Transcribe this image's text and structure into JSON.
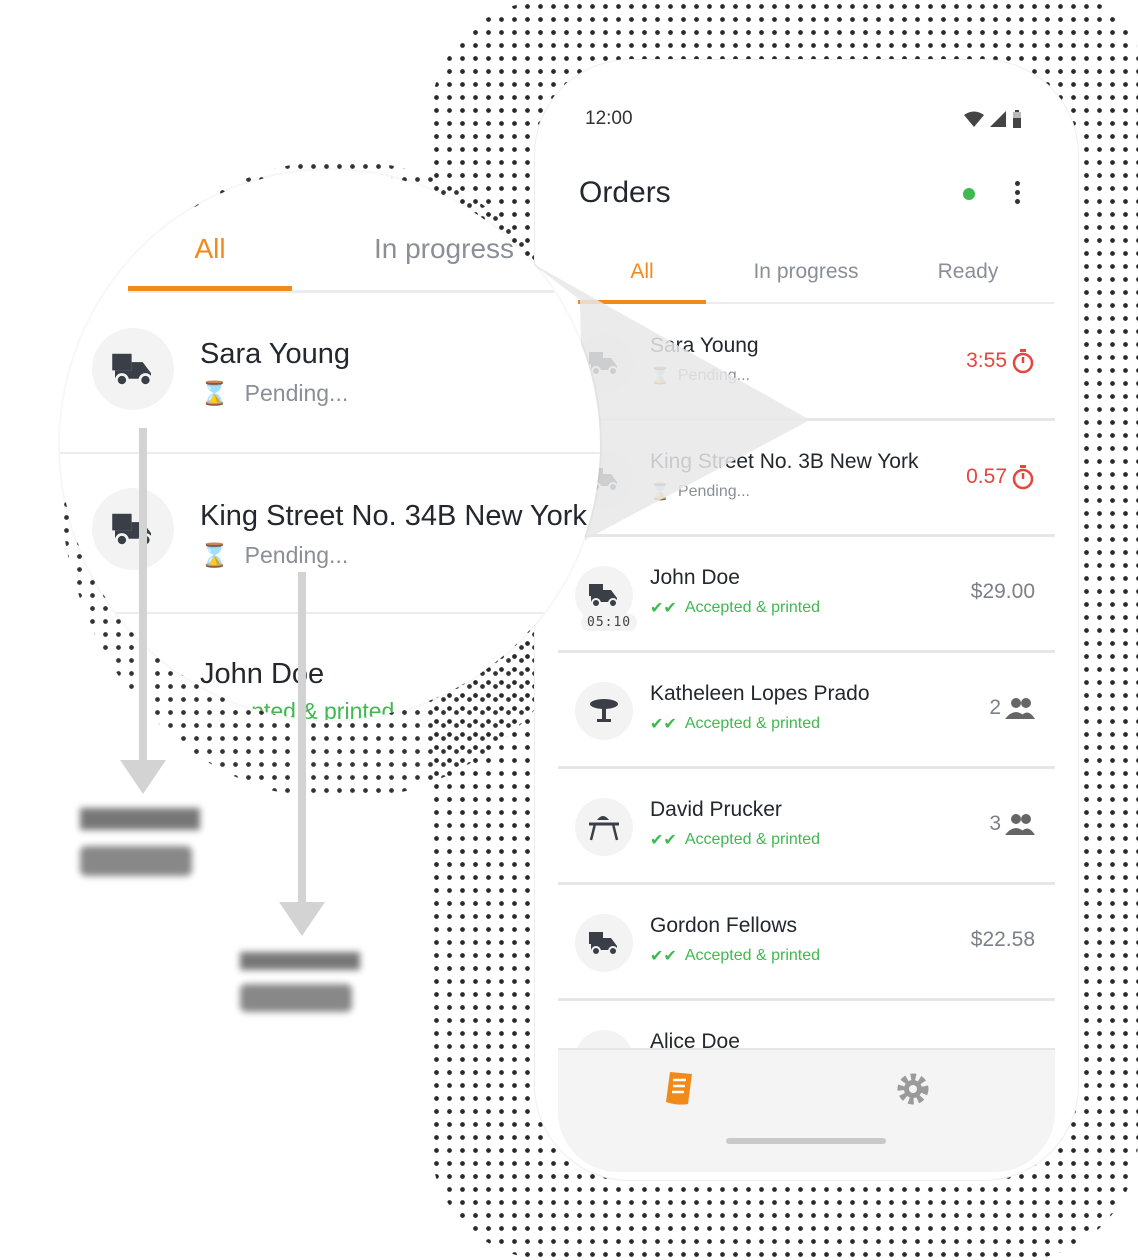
{
  "status_bar": {
    "time": "12:00"
  },
  "header": {
    "title": "Orders"
  },
  "tabs": [
    {
      "label": "All",
      "active": true
    },
    {
      "label": "In progress",
      "active": false
    },
    {
      "label": "Ready",
      "active": false
    }
  ],
  "orders": [
    {
      "name": "Sara Young",
      "status": "Pending...",
      "status_type": "pending",
      "right": "3:55",
      "right_type": "timer",
      "icon": "delivery-scooter-icon"
    },
    {
      "name": "King Street No. 3B New York",
      "status": "Pending...",
      "status_type": "pending",
      "right": "0.57",
      "right_type": "timer",
      "icon": "delivery-scooter-icon"
    },
    {
      "name": "John Doe",
      "status": "Accepted & printed",
      "status_type": "accepted",
      "right": "$29.00",
      "right_type": "price",
      "icon": "delivery-scooter-icon",
      "badge": "05:10"
    },
    {
      "name": "Katheleen Lopes Prado",
      "status": "Accepted & printed",
      "status_type": "accepted",
      "right": "2",
      "right_type": "guests",
      "icon": "table-icon"
    },
    {
      "name": "David Prucker",
      "status": "Accepted & printed",
      "status_type": "accepted",
      "right": "3",
      "right_type": "guests",
      "icon": "dine-in-icon"
    },
    {
      "name": "Gordon Fellows",
      "status": "Accepted & printed",
      "status_type": "accepted",
      "right": "$22.58",
      "right_type": "price",
      "icon": "delivery-scooter-icon"
    },
    {
      "name": "Alice Doe",
      "status": "",
      "status_type": "",
      "right": "",
      "right_type": "",
      "icon": "delivery-scooter-icon"
    }
  ],
  "magnifier": {
    "tabs": [
      "All",
      "In progress"
    ],
    "rows": [
      {
        "name": "Sara Young",
        "status": "Pending..."
      },
      {
        "name": "King Street No. 34B New York",
        "status": "Pending..."
      },
      {
        "name": "John Doe",
        "status": "Accepted & printed"
      }
    ]
  },
  "colors": {
    "accent": "#f28a1a",
    "alert": "#e5463d",
    "success": "#3fb950",
    "muted": "#8a8f97"
  }
}
